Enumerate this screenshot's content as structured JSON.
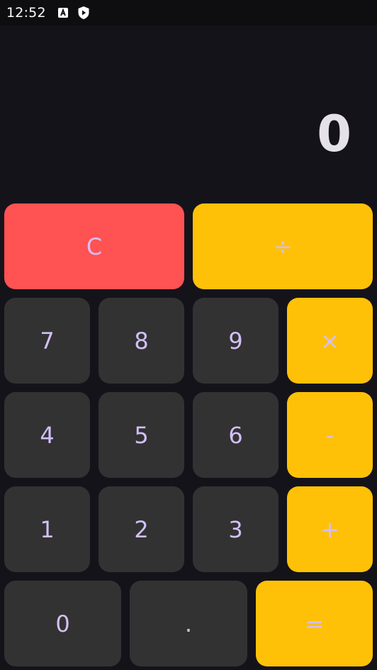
{
  "status_bar": {
    "time": "12:52",
    "icons": [
      "text-a-icon",
      "shield-play-icon"
    ]
  },
  "display": {
    "value": "0"
  },
  "keys": {
    "clear": "C",
    "divide": "÷",
    "multiply": "×",
    "subtract": "-",
    "add": "+",
    "equals": "=",
    "decimal": ".",
    "d0": "0",
    "d1": "1",
    "d2": "2",
    "d3": "3",
    "d4": "4",
    "d5": "5",
    "d6": "6",
    "d7": "7",
    "d8": "8",
    "d9": "9"
  },
  "colors": {
    "background": "#15131a",
    "number_key": "#323232",
    "operator_key": "#ffc107",
    "clear_key": "#ff5252",
    "key_text": "#d3bff7",
    "display_text": "#e4e1e8"
  }
}
